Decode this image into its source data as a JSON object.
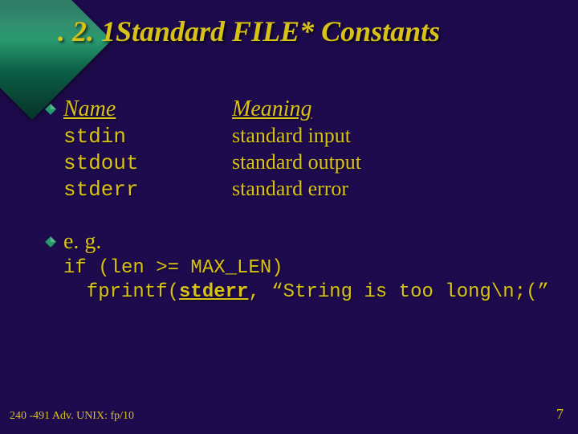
{
  "title": ". 2. 1Standard FILE* Constants",
  "headers": {
    "name": "Name",
    "meaning": "Meaning"
  },
  "rows": [
    {
      "name": "stdin",
      "meaning": "standard input"
    },
    {
      "name": "stdout",
      "meaning": "standard output"
    },
    {
      "name": "stderr",
      "meaning": "standard error"
    }
  ],
  "eg_label": "e. g.",
  "code": {
    "line1a": "if (len >= MAX_LEN)",
    "line2_pre": "  fprintf(",
    "line2_kw": "stderr",
    "line2_post": ", “String is too long\\n;(”"
  },
  "footer": {
    "left": "240 -491 Adv. UNIX: fp/10",
    "page": "7"
  }
}
